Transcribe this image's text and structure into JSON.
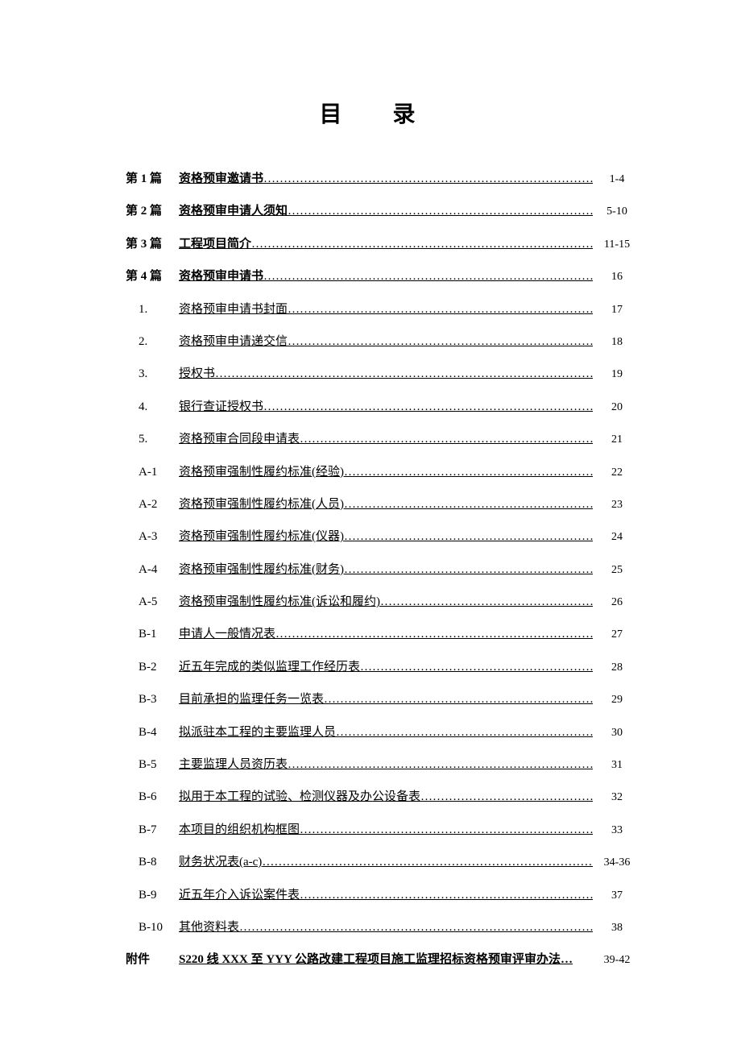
{
  "title": "目 录",
  "entries": [
    {
      "label": "第 1 篇",
      "labelBold": true,
      "sub": false,
      "title": "资格预审邀请书",
      "titleBold": true,
      "page": "1-4"
    },
    {
      "label": "第 2 篇",
      "labelBold": true,
      "sub": false,
      "title": "资格预审申请人须知",
      "titleBold": true,
      "page": "5-10"
    },
    {
      "label": "第 3 篇",
      "labelBold": true,
      "sub": false,
      "title": "工程项目简介",
      "titleBold": true,
      "page": "11-15"
    },
    {
      "label": "第 4 篇",
      "labelBold": true,
      "sub": false,
      "title": "资格预审申请书",
      "titleBold": true,
      "page": "16"
    },
    {
      "label": "1.",
      "labelBold": false,
      "sub": true,
      "title": "资格预审申请书封面",
      "titleBold": false,
      "page": "17"
    },
    {
      "label": "2.",
      "labelBold": false,
      "sub": true,
      "title": "资格预审申请递交信",
      "titleBold": false,
      "page": "18"
    },
    {
      "label": "3.",
      "labelBold": false,
      "sub": true,
      "title": "授权书",
      "titleBold": false,
      "page": "19"
    },
    {
      "label": "4.",
      "labelBold": false,
      "sub": true,
      "title": "银行查证授权书",
      "titleBold": false,
      "trailSpace": true,
      "page": "20"
    },
    {
      "label": "5.",
      "labelBold": false,
      "sub": true,
      "title": "资格预审合同段申请表",
      "titleBold": false,
      "page": "21"
    },
    {
      "label": "A-1",
      "labelBold": false,
      "sub": true,
      "title": "资格预审强制性履约标准(经验)",
      "titleBold": false,
      "trailSpace": true,
      "page": "22"
    },
    {
      "label": "A-2",
      "labelBold": false,
      "sub": true,
      "title": "资格预审强制性履约标准(人员)",
      "titleBold": false,
      "trailSpace": true,
      "page": "23"
    },
    {
      "label": "A-3",
      "labelBold": false,
      "sub": true,
      "title": "资格预审强制性履约标准(仪器)",
      "titleBold": false,
      "trailSpace": true,
      "page": "24"
    },
    {
      "label": "A-4",
      "labelBold": false,
      "sub": true,
      "title": "资格预审强制性履约标准(财务)",
      "titleBold": false,
      "trailSpace": true,
      "page": "25"
    },
    {
      "label": "A-5",
      "labelBold": false,
      "sub": true,
      "title": "资格预审强制性履约标准(诉讼和履约)",
      "titleBold": false,
      "trailSpace": true,
      "page": "26"
    },
    {
      "label": "B-1",
      "labelBold": false,
      "sub": true,
      "title": "申请人一般情况表",
      "titleBold": false,
      "page": "27"
    },
    {
      "label": "B-2",
      "labelBold": false,
      "sub": true,
      "title": "近五年完成的类似监理工作经历表",
      "titleBold": false,
      "page": "28"
    },
    {
      "label": "B-3",
      "labelBold": false,
      "sub": true,
      "title": "目前承担的监理任务一览表",
      "titleBold": false,
      "page": "29"
    },
    {
      "label": "B-4",
      "labelBold": false,
      "sub": true,
      "title": "拟派驻本工程的主要监理人员",
      "titleBold": false,
      "page": "30"
    },
    {
      "label": "B-5",
      "labelBold": false,
      "sub": true,
      "title": "主要监理人员资历表",
      "titleBold": false,
      "page": "31"
    },
    {
      "label": "B-6",
      "labelBold": false,
      "sub": true,
      "title": "拟用于本工程的试验、检测仪器及办公设备表",
      "titleBold": false,
      "page": "32"
    },
    {
      "label": "B-7",
      "labelBold": false,
      "sub": true,
      "title": "本项目的组织机构框图",
      "titleBold": false,
      "page": "33"
    },
    {
      "label": "B-8",
      "labelBold": false,
      "sub": true,
      "title": "财务状况表(a-c)",
      "titleBold": false,
      "trailSpace": true,
      "page": "34-36"
    },
    {
      "label": "B-9",
      "labelBold": false,
      "sub": true,
      "title": "近五年介入诉讼案件表",
      "titleBold": false,
      "page": "37"
    },
    {
      "label": "B-10",
      "labelBold": false,
      "sub": true,
      "title": "其他资料表",
      "titleBold": false,
      "page": "38"
    },
    {
      "label": "附件",
      "labelBold": true,
      "sub": false,
      "title": "S220 线 XXX 至 YYY 公路改建工程项目施工监理招标资格预审评审办法…",
      "titleBold": true,
      "noDots": true,
      "page": "39-42"
    }
  ]
}
